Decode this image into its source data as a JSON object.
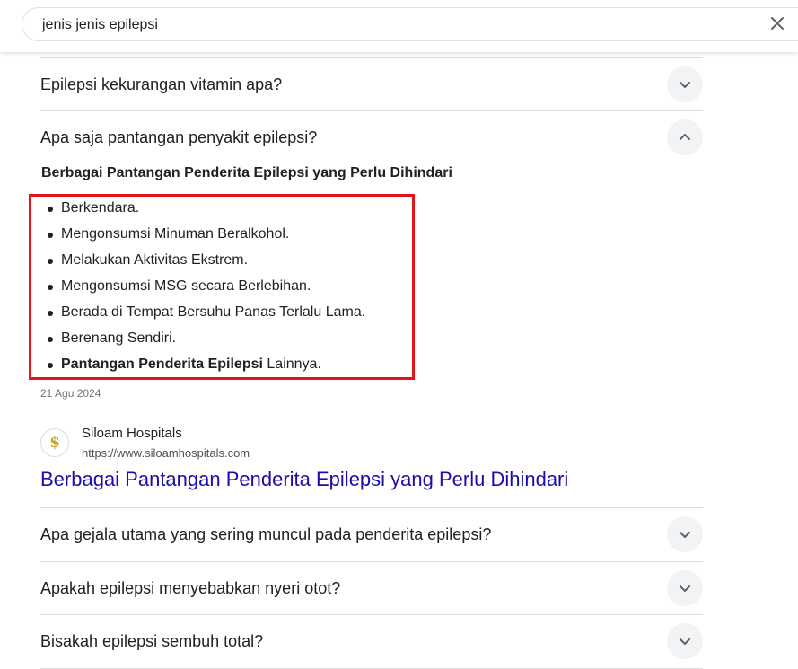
{
  "search": {
    "query": "jenis jenis epilepsi"
  },
  "faq": [
    {
      "question": "Epilepsi kekurangan vitamin apa?",
      "expanded": false
    },
    {
      "question": "Apa saja pantangan penyakit epilepsi?",
      "expanded": true
    },
    {
      "question": "Apa gejala utama yang sering muncul pada penderita epilepsi?",
      "expanded": false
    },
    {
      "question": "Apakah epilepsi menyebabkan nyeri otot?",
      "expanded": false
    },
    {
      "question": "Bisakah epilepsi sembuh total?",
      "expanded": false
    }
  ],
  "answer": {
    "heading": "Berbagai Pantangan Penderita Epilepsi yang Perlu Dihindari",
    "items": [
      "Berkendara.",
      "Mengonsumsi Minuman Beralkohol.",
      "Melakukan Aktivitas Ekstrem.",
      "Mengonsumsi MSG secara Berlebihan.",
      "Berada di Tempat Bersuhu Panas Terlalu Lama.",
      "Berenang Sendiri."
    ],
    "last_item_bold": "Pantangan Penderita Epilepsi",
    "last_item_rest": " Lainnya.",
    "date": "21 Agu 2024",
    "source_name": "Siloam Hospitals",
    "source_url": "https://www.siloamhospitals.com",
    "source_icon_glyph": "$",
    "link_title": "Berbagai Pantangan Penderita Epilepsi yang Perlu Dihindari"
  },
  "colors": {
    "link": "#1a0dab",
    "highlight": "#e8141b",
    "chevron_bg": "#f1f3f4"
  },
  "icons": {
    "clear": "close-icon",
    "collapsed": "chevron-down-icon",
    "expanded": "chevron-up-icon"
  }
}
